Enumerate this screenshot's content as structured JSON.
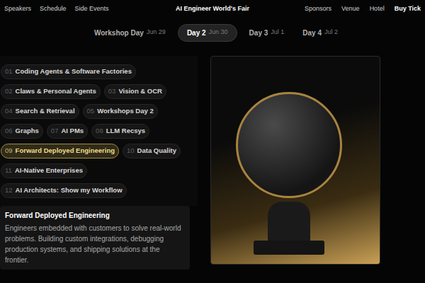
{
  "nav": {
    "left": [
      "Speakers",
      "Schedule",
      "Side Events"
    ],
    "title": "AI Engineer World's Fair",
    "right": [
      "Sponsors",
      "Venue",
      "Hotel",
      "Buy Tick"
    ]
  },
  "days": [
    {
      "label": "Workshop Day",
      "date": "Jun 29",
      "selected": false
    },
    {
      "label": "Day 2",
      "date": "Jun 30",
      "selected": true
    },
    {
      "label": "Day 3",
      "date": "Jul 1",
      "selected": false
    },
    {
      "label": "Day 4",
      "date": "Jul 2",
      "selected": false
    }
  ],
  "track_rows": [
    [
      {
        "number": "01",
        "label": "Coding Agents & Software Factories",
        "selected": false
      }
    ],
    [
      {
        "number": "02",
        "label": "Claws & Personal Agents",
        "selected": false
      },
      {
        "number": "03",
        "label": "Vision & OCR",
        "selected": false
      }
    ],
    [
      {
        "number": "04",
        "label": "Search & Retrieval",
        "selected": false
      },
      {
        "number": "05",
        "label": "Workshops Day 2",
        "selected": false
      }
    ],
    [
      {
        "number": "06",
        "label": "Graphs",
        "selected": false
      },
      {
        "number": "07",
        "label": "AI PMs",
        "selected": false
      },
      {
        "number": "08",
        "label": "LLM Recsys",
        "selected": false
      }
    ],
    [
      {
        "number": "09",
        "label": "Forward Deployed Engineering",
        "selected": true
      },
      {
        "number": "10",
        "label": "Data Quality",
        "selected": false
      }
    ],
    [
      {
        "number": "11",
        "label": "AI-Native Enterprises",
        "selected": false
      }
    ],
    [
      {
        "number": "12",
        "label": "AI Architects: Show my Workflow",
        "selected": false
      }
    ]
  ],
  "detail": {
    "title": "Forward Deployed Engineering",
    "description": "Engineers embedded with customers to solve real-world problems. Building custom integrations, debugging production systems, and shipping solutions at the frontier."
  }
}
